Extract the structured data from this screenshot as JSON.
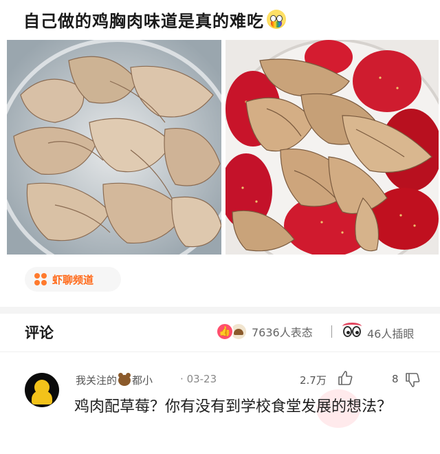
{
  "post": {
    "title": "自己做的鸡胸肉味道是真的难吃",
    "title_emoji": "flushed-rainbow-face-emoji"
  },
  "photos": [
    {
      "name": "shredded-chicken-in-bowl"
    },
    {
      "name": "shredded-chicken-with-strawberries"
    }
  ],
  "channel": {
    "icon": "orange-flower-icon",
    "label": "虾聊频道",
    "accent": "#ff6a1a"
  },
  "comments_header": {
    "title": "评论",
    "reactions_label": "7636人表态",
    "peek_label": "46人插眼"
  },
  "comment": {
    "username_prefix": "我关注的",
    "username_suffix": "都小",
    "separator": "·",
    "date": "03-23",
    "likes": "2.7万",
    "dislikes": "8",
    "text": "鸡肉配草莓？你有没有到学校食堂发展的想法？"
  }
}
